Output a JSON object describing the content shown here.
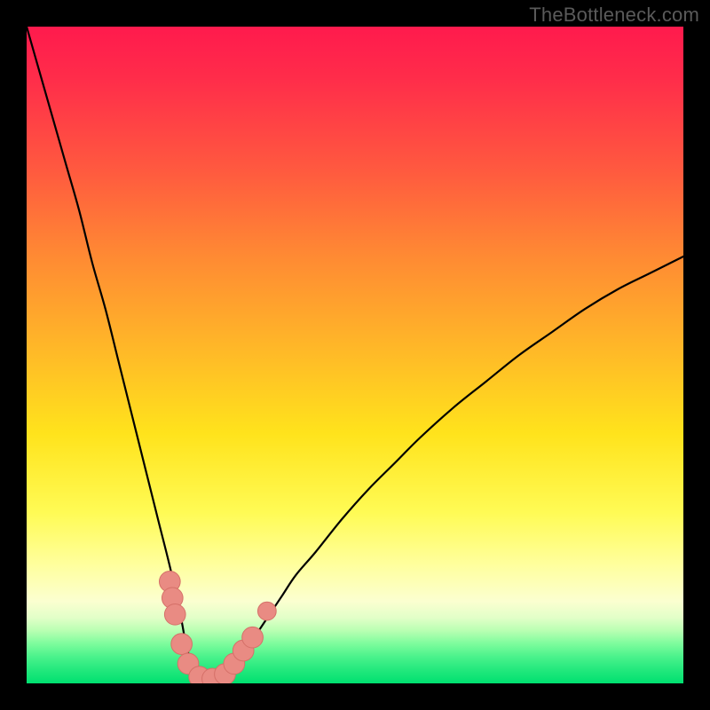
{
  "watermark": "TheBottleneck.com",
  "colors": {
    "frame": "#000000",
    "curve": "#000000",
    "marker_fill": "#e98b83",
    "marker_stroke": "#d57068",
    "gradient_top": "#ff1a4d",
    "gradient_bottom": "#00e070"
  },
  "chart_data": {
    "type": "line",
    "title": "",
    "xlabel": "",
    "ylabel": "",
    "xlim": [
      0,
      100
    ],
    "ylim": [
      0,
      100
    ],
    "note": "Bottleneck curve: x is relative position along horizontal axis (0–100), y is bottleneck percentage (0–100). Values estimated from pixel positions; no axis ticks are shown in the source image.",
    "series": [
      {
        "name": "bottleneck-curve",
        "x": [
          0,
          2,
          4,
          6,
          8,
          10,
          12,
          14,
          16,
          18,
          20,
          22,
          23.5,
          24.5,
          26,
          27.5,
          28.5,
          30,
          31.5,
          33,
          35,
          37,
          39,
          41,
          44,
          48,
          52,
          56,
          60,
          65,
          70,
          75,
          80,
          85,
          90,
          95,
          100
        ],
        "y": [
          100,
          93,
          86,
          79,
          72,
          64,
          57,
          49,
          41,
          33,
          25,
          17,
          10,
          5,
          1.5,
          0.5,
          0.5,
          1,
          2.5,
          4.5,
          7.5,
          10.5,
          13.5,
          16.5,
          20,
          25,
          29.5,
          33.5,
          37.5,
          42,
          46,
          50,
          53.5,
          57,
          60,
          62.5,
          65
        ]
      }
    ],
    "markers": [
      {
        "x": 21.8,
        "y": 15.5,
        "r": 1.6
      },
      {
        "x": 22.2,
        "y": 13.0,
        "r": 1.6
      },
      {
        "x": 22.6,
        "y": 10.5,
        "r": 1.6
      },
      {
        "x": 23.6,
        "y": 6.0,
        "r": 1.6
      },
      {
        "x": 24.6,
        "y": 3.0,
        "r": 1.6
      },
      {
        "x": 26.3,
        "y": 1.0,
        "r": 1.6
      },
      {
        "x": 28.3,
        "y": 0.7,
        "r": 1.6
      },
      {
        "x": 30.2,
        "y": 1.4,
        "r": 1.6
      },
      {
        "x": 31.6,
        "y": 3.0,
        "r": 1.6
      },
      {
        "x": 33.0,
        "y": 5.0,
        "r": 1.6
      },
      {
        "x": 34.4,
        "y": 7.0,
        "r": 1.6
      },
      {
        "x": 36.6,
        "y": 11.0,
        "r": 1.4
      }
    ]
  }
}
